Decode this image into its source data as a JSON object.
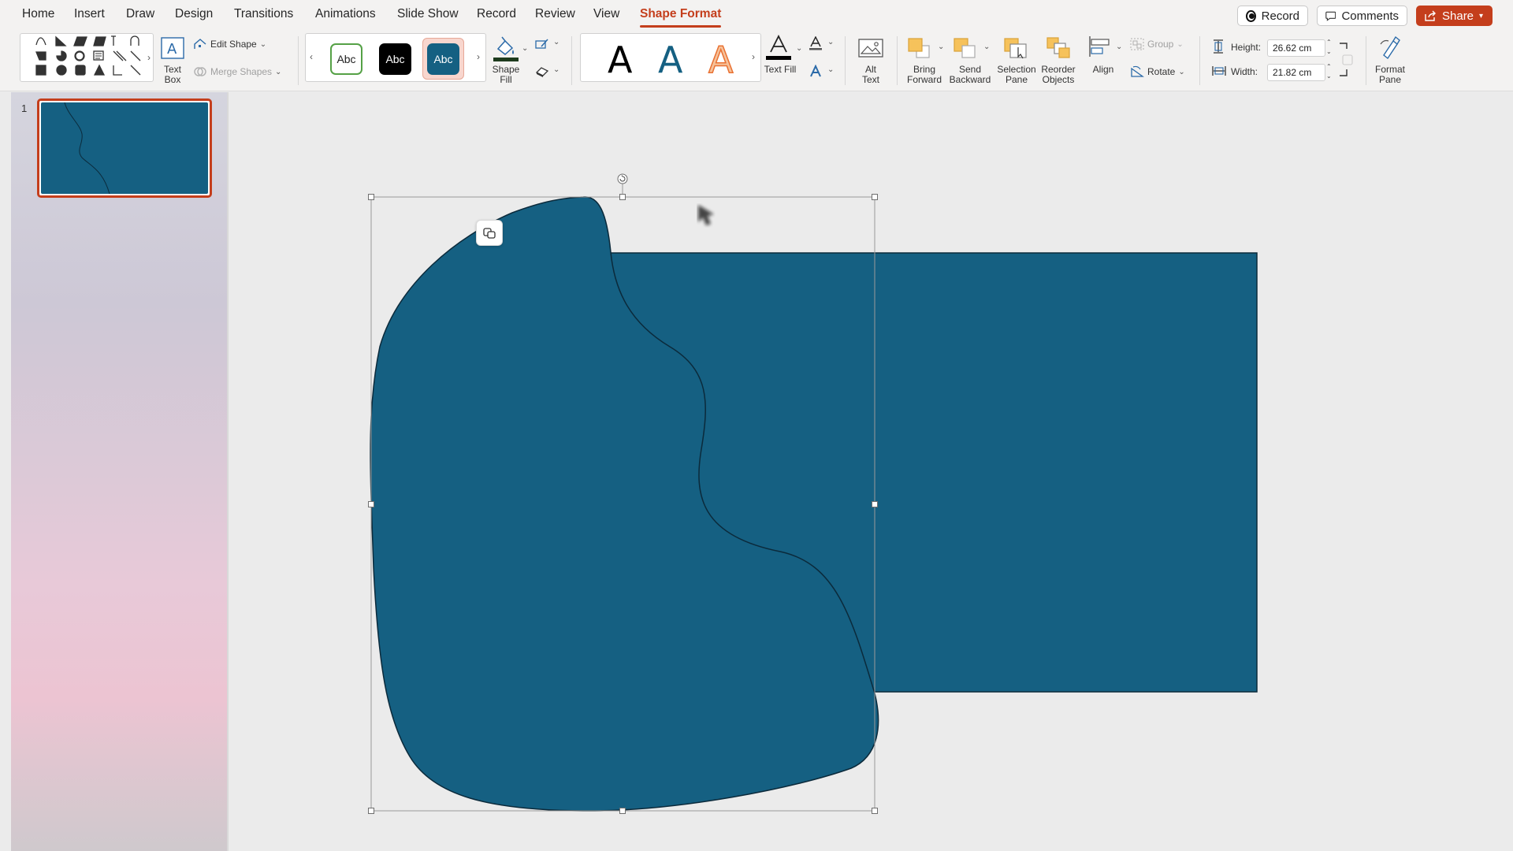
{
  "tabs": [
    "Home",
    "Insert",
    "Draw",
    "Design",
    "Transitions",
    "Animations",
    "Slide Show",
    "Record",
    "Review",
    "View",
    "Shape Format"
  ],
  "active_tab": "Shape Format",
  "top_right": {
    "record": "Record",
    "comments": "Comments",
    "share": "Share"
  },
  "ribbon": {
    "text_box": "Text\nBox",
    "edit_shape": "Edit Shape",
    "merge_shapes": "Merge Shapes",
    "style_sample": "Abc",
    "shape_fill": "Shape\nFill",
    "wordart_letter": "A",
    "text_fill": "Text Fill",
    "alt_text": "Alt\nText",
    "bring_forward": "Bring\nForward",
    "send_backward": "Send\nBackward",
    "selection_pane": "Selection\nPane",
    "reorder_objects": "Reorder\nObjects",
    "align": "Align",
    "group": "Group",
    "rotate": "Rotate",
    "height_label": "Height:",
    "height_value": "26.62 cm",
    "width_label": "Width:",
    "width_value": "21.82 cm",
    "format_pane": "Format\nPane"
  },
  "slides": [
    {
      "number": "1"
    }
  ],
  "colors": {
    "accent": "#c43e1c",
    "shape_fill": "#156082",
    "ribbon_bg": "#f3f2f1",
    "canvas_bg": "#ebebeb"
  }
}
